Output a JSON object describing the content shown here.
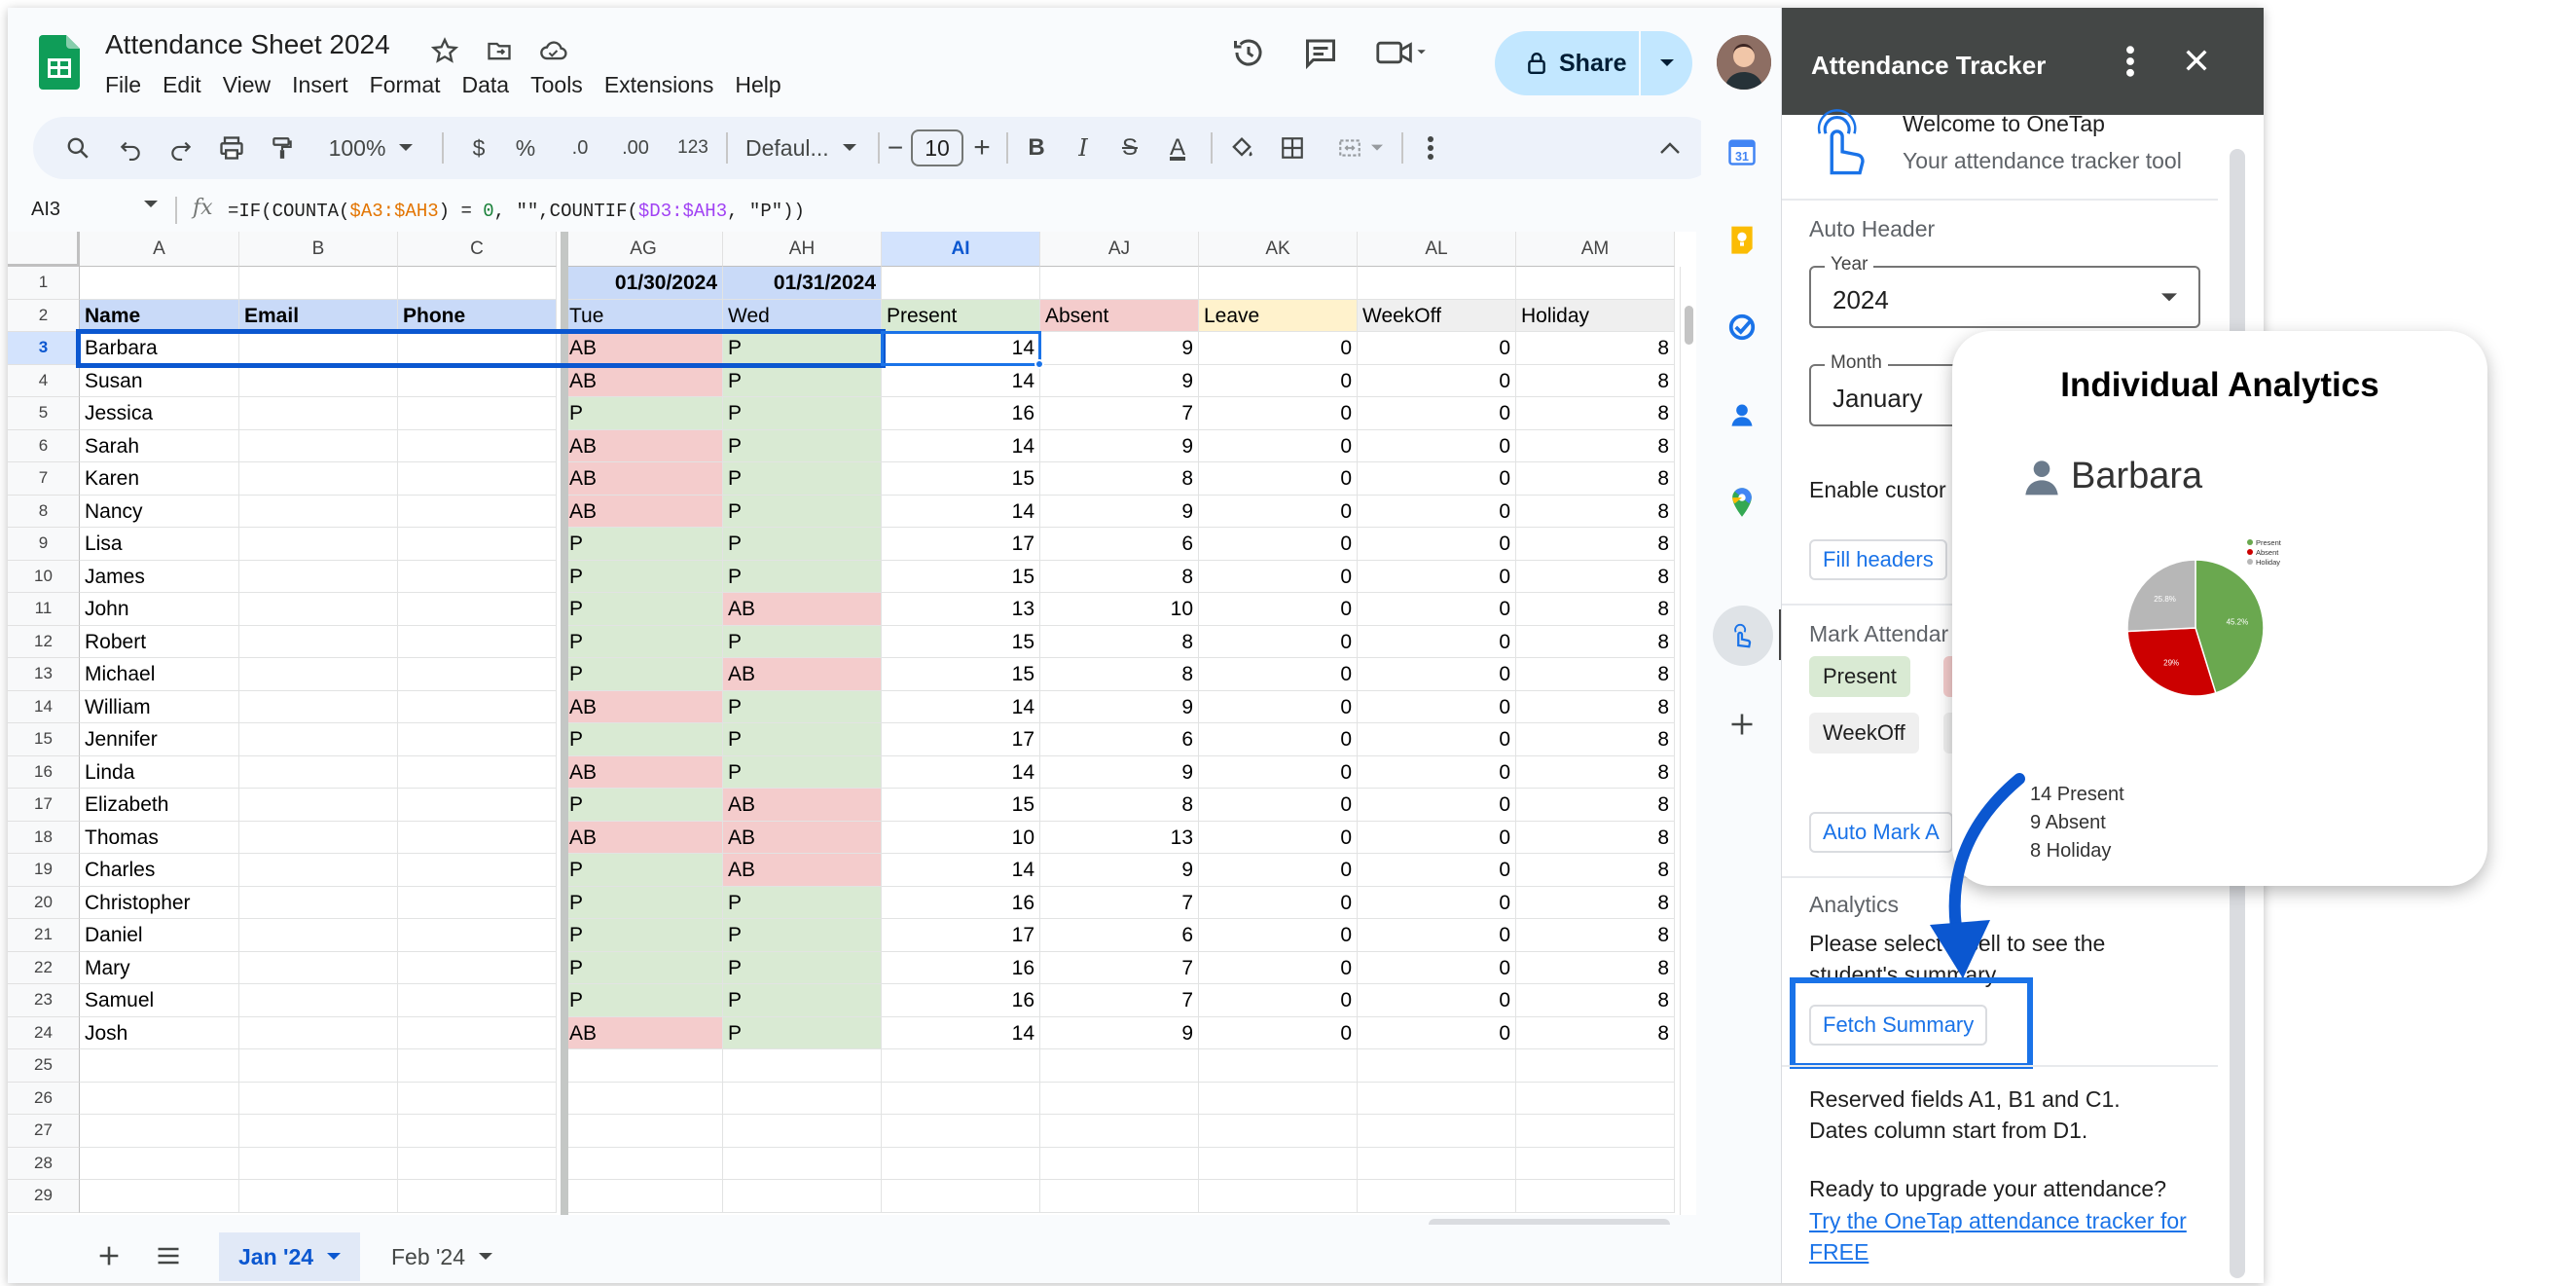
{
  "header": {
    "doc_title": "Attendance Sheet 2024",
    "menu": [
      "File",
      "Edit",
      "View",
      "Insert",
      "Format",
      "Data",
      "Tools",
      "Extensions",
      "Help"
    ],
    "share_label": "Share"
  },
  "toolbar": {
    "zoom": "100%",
    "currency": "$",
    "percent": "%",
    "dec_decrease": ".0",
    "dec_increase": ".00",
    "number_format": "123",
    "font": "Defaul...",
    "minus": "−",
    "font_size": "10",
    "plus": "+",
    "bold": "B",
    "italic": "I",
    "strike": "S",
    "text_color": "A"
  },
  "formula_bar": {
    "name_box": "AI3",
    "fx": "fx",
    "formula_parts": [
      "=IF(COUNTA(",
      "$A3:$AH3",
      ") = ",
      "0",
      ", \"\",COUNTIF(",
      "$D3:$AH3",
      ", \"P\"))"
    ]
  },
  "columns": [
    {
      "letter": "A",
      "w": 164
    },
    {
      "letter": "B",
      "w": 163
    },
    {
      "letter": "C",
      "w": 163
    },
    {
      "letter": "AG",
      "w": 163
    },
    {
      "letter": "AH",
      "w": 163
    },
    {
      "letter": "AI",
      "w": 163,
      "selected": true
    },
    {
      "letter": "AJ",
      "w": 163
    },
    {
      "letter": "AK",
      "w": 163
    },
    {
      "letter": "AL",
      "w": 163
    },
    {
      "letter": "AM",
      "w": 163
    }
  ],
  "row1": [
    "",
    "",
    "",
    "01/30/2024",
    "01/31/2024",
    "",
    "",
    "",
    "",
    ""
  ],
  "row2": [
    "Name",
    "Email",
    "Phone",
    "Tue",
    "Wed",
    "Present",
    "Absent",
    "Leave",
    "WeekOff",
    "Holiday"
  ],
  "students": [
    [
      "Barbara",
      "AB",
      "P",
      14,
      9,
      0,
      0,
      8
    ],
    [
      "Susan",
      "AB",
      "P",
      14,
      9,
      0,
      0,
      8
    ],
    [
      "Jessica",
      "P",
      "P",
      16,
      7,
      0,
      0,
      8
    ],
    [
      "Sarah",
      "AB",
      "P",
      14,
      9,
      0,
      0,
      8
    ],
    [
      "Karen",
      "AB",
      "P",
      15,
      8,
      0,
      0,
      8
    ],
    [
      "Nancy",
      "AB",
      "P",
      14,
      9,
      0,
      0,
      8
    ],
    [
      "Lisa",
      "P",
      "P",
      17,
      6,
      0,
      0,
      8
    ],
    [
      "James",
      "P",
      "P",
      15,
      8,
      0,
      0,
      8
    ],
    [
      "John",
      "P",
      "AB",
      13,
      10,
      0,
      0,
      8
    ],
    [
      "Robert",
      "P",
      "P",
      15,
      8,
      0,
      0,
      8
    ],
    [
      "Michael",
      "P",
      "AB",
      15,
      8,
      0,
      0,
      8
    ],
    [
      "William",
      "AB",
      "P",
      14,
      9,
      0,
      0,
      8
    ],
    [
      "Jennifer",
      "P",
      "P",
      17,
      6,
      0,
      0,
      8
    ],
    [
      "Linda",
      "AB",
      "P",
      14,
      9,
      0,
      0,
      8
    ],
    [
      "Elizabeth",
      "P",
      "AB",
      15,
      8,
      0,
      0,
      8
    ],
    [
      "Thomas",
      "AB",
      "AB",
      10,
      13,
      0,
      0,
      8
    ],
    [
      "Charles",
      "P",
      "AB",
      14,
      9,
      0,
      0,
      8
    ],
    [
      "Christopher",
      "P",
      "P",
      16,
      7,
      0,
      0,
      8
    ],
    [
      "Daniel",
      "P",
      "P",
      17,
      6,
      0,
      0,
      8
    ],
    [
      "Mary",
      "P",
      "P",
      16,
      7,
      0,
      0,
      8
    ],
    [
      "Samuel",
      "P",
      "P",
      16,
      7,
      0,
      0,
      8
    ],
    [
      "Josh",
      "AB",
      "P",
      14,
      9,
      0,
      0,
      8
    ]
  ],
  "row_numbers": [
    "1",
    "2",
    "3",
    "4",
    "5",
    "6",
    "7",
    "8",
    "9",
    "10",
    "11",
    "12",
    "13",
    "14",
    "15",
    "16",
    "17",
    "18",
    "19",
    "20",
    "21",
    "22",
    "23",
    "24",
    "25",
    "26",
    "27",
    "28",
    "29"
  ],
  "colors": {
    "present_bg": "#d9ead3",
    "absent_bg": "#f4cccc",
    "leave_bg": "#fff2cc",
    "header_blue": "#c9daf8",
    "accent": "#0b57d0"
  },
  "tabs": [
    {
      "label": "Jan '24",
      "active": true
    },
    {
      "label": "Feb '24",
      "active": false
    }
  ],
  "panel": {
    "title": "Attendance Tracker",
    "welcome": "Welcome to OneTap",
    "welcome_sub": "Your attendance tracker tool",
    "auto_header": "Auto Header",
    "year_label": "Year",
    "year_value": "2024",
    "month_label": "Month",
    "month_value": "January",
    "enable_custom": "Enable custor",
    "fill_headers": "Fill headers",
    "mark_attendance": "Mark Attendar",
    "chip_present": "Present",
    "chip_absent_partial": "A",
    "chip_weekoff": "WeekOff",
    "auto_mark": "Auto Mark A",
    "analytics": "Analytics",
    "analytics_desc_1": "Please select a cell to see the",
    "analytics_desc_2": "student's summary",
    "fetch_summary": "Fetch Summary",
    "reserved_1": "Reserved fields A1, B1 and C1.",
    "reserved_2": "Dates column start from D1.",
    "upgrade": "Ready to upgrade your attendance?",
    "link_1": "Try the OneTap attendance tracker for",
    "link_2": "FREE"
  },
  "analytics_card": {
    "title": "Individual Analytics",
    "student": "Barbara",
    "stat_present": "14 Present",
    "stat_absent": "9 Absent",
    "stat_holiday": "8 Holiday"
  },
  "chart_data": {
    "type": "pie",
    "categories": [
      "Present",
      "Absent",
      "Holiday"
    ],
    "values": [
      45.2,
      29,
      25.8
    ],
    "labels": [
      "45.2%",
      "29%",
      "25.8%"
    ],
    "colors": [
      "#6aa84f",
      "#cc0000",
      "#b7b7b7"
    ],
    "legend": "top-right"
  }
}
